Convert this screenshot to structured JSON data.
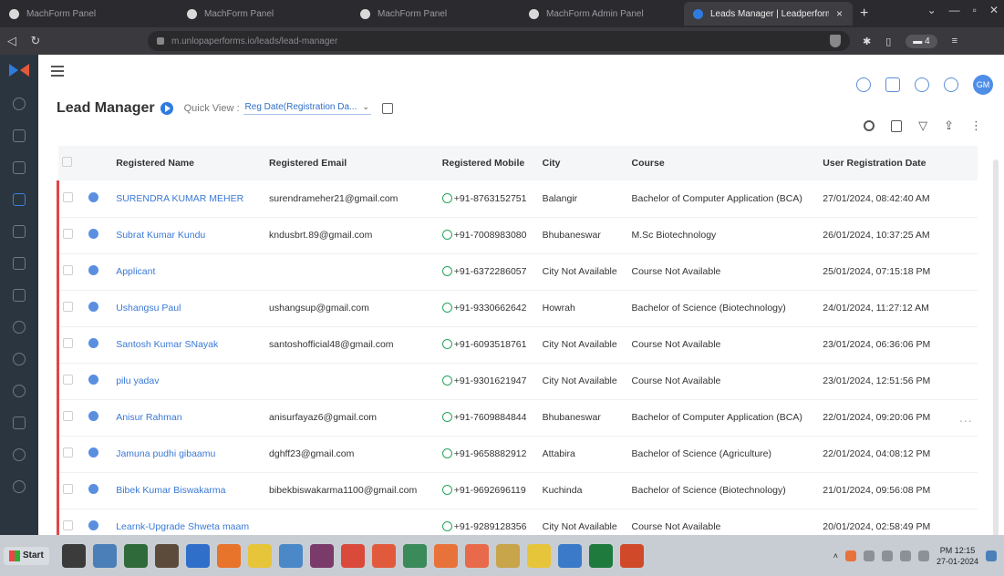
{
  "browser": {
    "tabs": [
      {
        "label": "MachForm Panel",
        "active": false
      },
      {
        "label": "MachForm Panel",
        "active": false
      },
      {
        "label": "MachForm Panel",
        "active": false
      },
      {
        "label": "MachForm Admin Panel",
        "active": false
      },
      {
        "label": "Leads Manager | Leadperforms.com",
        "active": true
      }
    ],
    "url": "m.unlopaperforms.io/leads/lead-manager",
    "wallet_label": "4"
  },
  "header": {
    "title": "Lead Manager",
    "quick_view_label": "Quick View :",
    "quick_view_value": "Reg Date(Registration Da...",
    "avatar_initials": "GM"
  },
  "table": {
    "columns": [
      "Registered Name",
      "Registered Email",
      "Registered Mobile",
      "City",
      "Course",
      "User Registration Date"
    ],
    "rows": [
      {
        "name": "SURENDRA KUMAR MEHER",
        "email": "surendrameher21@gmail.com",
        "mobile": "+91-8763152751",
        "city": "Balangir",
        "course": "Bachelor of Computer Application (BCA)",
        "date": "27/01/2024, 08:42:40 AM"
      },
      {
        "name": "Subrat Kumar Kundu",
        "email": "kndusbrt.89@gmail.com",
        "mobile": "+91-7008983080",
        "city": "Bhubaneswar",
        "course": "M.Sc Biotechnology",
        "date": "26/01/2024, 10:37:25 AM"
      },
      {
        "name": "Applicant",
        "email": "",
        "mobile": "+91-6372286057",
        "city": "City Not Available",
        "course": "Course Not Available",
        "date": "25/01/2024, 07:15:18 PM"
      },
      {
        "name": "Ushangsu Paul",
        "email": "ushangsup@gmail.com",
        "mobile": "+91-9330662642",
        "city": "Howrah",
        "course": "Bachelor of Science (Biotechnology)",
        "date": "24/01/2024, 11:27:12 AM"
      },
      {
        "name": "Santosh Kumar SNayak",
        "email": "santoshofficial48@gmail.com",
        "mobile": "+91-6093518761",
        "city": "City Not Available",
        "course": "Course Not Available",
        "date": "23/01/2024, 06:36:06 PM"
      },
      {
        "name": "pilu yadav",
        "email": "",
        "mobile": "+91-9301621947",
        "city": "City Not Available",
        "course": "Course Not Available",
        "date": "23/01/2024, 12:51:56 PM"
      },
      {
        "name": "Anisur Rahman",
        "email": "anisurfayaz6@gmail.com",
        "mobile": "+91-7609884844",
        "city": "Bhubaneswar",
        "course": "Bachelor of Computer Application (BCA)",
        "date": "22/01/2024, 09:20:06 PM"
      },
      {
        "name": "Jamuna pudhi gibaamu",
        "email": "dghff23@gmail.com",
        "mobile": "+91-9658882912",
        "city": "Attabira",
        "course": "Bachelor of Science (Agriculture)",
        "date": "22/01/2024, 04:08:12 PM"
      },
      {
        "name": "Bibek Kumar Biswakarma",
        "email": "bibekbiswakarma1100@gmail.com",
        "mobile": "+91-9692696119",
        "city": "Kuchinda",
        "course": "Bachelor of Science (Biotechnology)",
        "date": "21/01/2024, 09:56:08 PM"
      },
      {
        "name": "Learnk-Upgrade Shweta maam",
        "email": "",
        "mobile": "+91-9289128356",
        "city": "City Not Available",
        "course": "Course Not Available",
        "date": "20/01/2024, 02:58:49 PM"
      }
    ],
    "more_label": "..."
  },
  "taskbar": {
    "start_label": "Start",
    "clock_time": "PM 12:15",
    "clock_date": "27-01-2024",
    "apps": [
      {
        "icon": "cmd-icon",
        "color": "#3b3b3b"
      },
      {
        "icon": "control-panel-icon",
        "color": "#4a7fb8"
      },
      {
        "icon": "folder-icon",
        "color": "#2f6b3a"
      },
      {
        "icon": "app-icon",
        "color": "#5c4b3a"
      },
      {
        "icon": "r-icon",
        "color": "#2f6fc9"
      },
      {
        "icon": "firefox-icon",
        "color": "#e8732a"
      },
      {
        "icon": "pencil-icon",
        "color": "#e7c53a"
      },
      {
        "icon": "files-icon",
        "color": "#4a88c8"
      },
      {
        "icon": "winrar-icon",
        "color": "#7a3a6a"
      },
      {
        "icon": "chrome-icon",
        "color": "#d94a3a"
      },
      {
        "icon": "brave-icon",
        "color": "#e25a3c"
      },
      {
        "icon": "globe-icon",
        "color": "#3a8a5a"
      },
      {
        "icon": "orange-app-icon",
        "color": "#e8733a"
      },
      {
        "icon": "orange-app-icon",
        "color": "#e86a4a"
      },
      {
        "icon": "paint-icon",
        "color": "#c8a44a"
      },
      {
        "icon": "explorer-icon",
        "color": "#e7c53a"
      },
      {
        "icon": "notepad-icon",
        "color": "#3a7ac8"
      },
      {
        "icon": "excel-icon",
        "color": "#1f7a3e"
      },
      {
        "icon": "powerpoint-icon",
        "color": "#d04a2a"
      }
    ]
  }
}
